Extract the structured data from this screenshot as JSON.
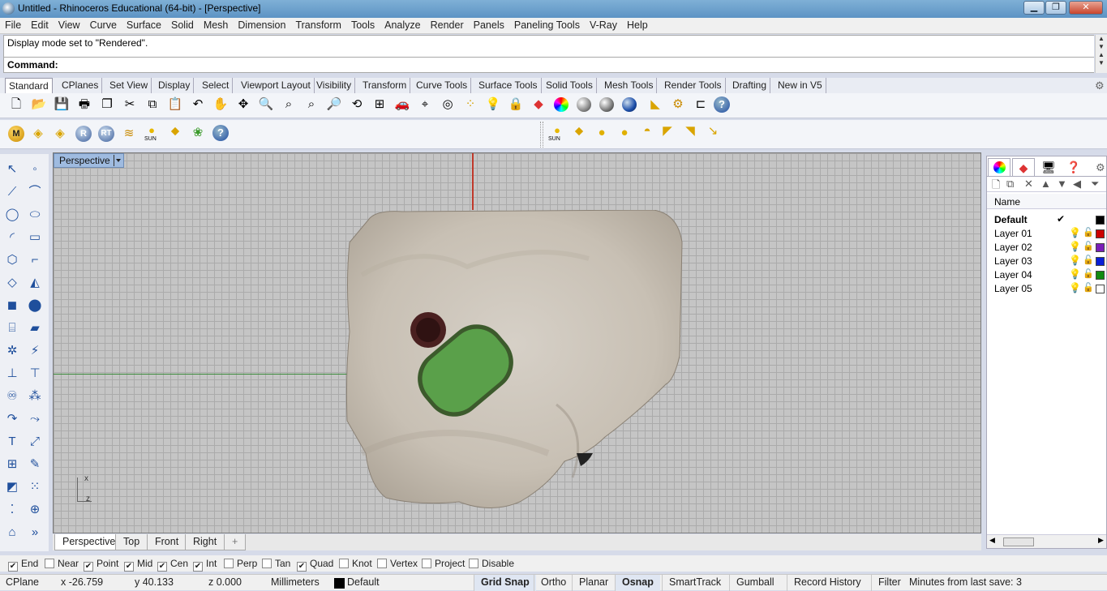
{
  "window": {
    "title": "Untitled - Rhinoceros Educational (64-bit) - [Perspective]",
    "minimize": "▁",
    "maximize": "❐",
    "close": "✕"
  },
  "menu": [
    "File",
    "Edit",
    "View",
    "Curve",
    "Surface",
    "Solid",
    "Mesh",
    "Dimension",
    "Transform",
    "Tools",
    "Analyze",
    "Render",
    "Panels",
    "Paneling Tools",
    "V-Ray",
    "Help"
  ],
  "command": {
    "history": "Display mode set to \"Rendered\".",
    "prompt": "Command:"
  },
  "toolbar_tabs": [
    "Standard",
    "CPlanes",
    "Set View",
    "Display",
    "Select",
    "Viewport Layout",
    "Visibility",
    "Transform",
    "Curve Tools",
    "Surface Tools",
    "Solid Tools",
    "Mesh Tools",
    "Render Tools",
    "Drafting",
    "New in V5"
  ],
  "toolbar2": {
    "sun_label": "SUN",
    "sun_label2": "SUN",
    "icons": [
      "M",
      "R",
      "RT"
    ]
  },
  "viewport": {
    "name": "Perspective",
    "axis_x": "x",
    "axis_z": "z"
  },
  "viewport_tabs": [
    "Perspective",
    "Top",
    "Front",
    "Right",
    "+"
  ],
  "osnaps": [
    {
      "label": "End",
      "checked": true
    },
    {
      "label": "Near",
      "checked": false
    },
    {
      "label": "Point",
      "checked": true
    },
    {
      "label": "Mid",
      "checked": true
    },
    {
      "label": "Cen",
      "checked": true
    },
    {
      "label": "Int",
      "checked": true
    },
    {
      "label": "Perp",
      "checked": false
    },
    {
      "label": "Tan",
      "checked": false
    },
    {
      "label": "Quad",
      "checked": true
    },
    {
      "label": "Knot",
      "checked": false
    },
    {
      "label": "Vertex",
      "checked": false
    },
    {
      "label": "Project",
      "checked": false
    },
    {
      "label": "Disable",
      "checked": false
    }
  ],
  "status": {
    "cplane": "CPlane",
    "x": "x -26.759",
    "y": "y 40.133",
    "z": "z 0.000",
    "units": "Millimeters",
    "layer": "Default",
    "grid_snap": "Grid Snap",
    "ortho": "Ortho",
    "planar": "Planar",
    "osnap": "Osnap",
    "smarttrack": "SmartTrack",
    "gumball": "Gumball",
    "record_history": "Record History",
    "filter": "Filter",
    "save_info": "Minutes from last save: 3"
  },
  "layers": {
    "header": "Name",
    "items": [
      {
        "name": "Default",
        "current": true,
        "color": "#000000",
        "check": "✔"
      },
      {
        "name": "Layer 01",
        "color": "#cc0000"
      },
      {
        "name": "Layer 02",
        "color": "#7a1fb8"
      },
      {
        "name": "Layer 03",
        "color": "#0a1fd6"
      },
      {
        "name": "Layer 04",
        "color": "#118a11"
      },
      {
        "name": "Layer 05",
        "color": "#ffffff"
      }
    ]
  }
}
